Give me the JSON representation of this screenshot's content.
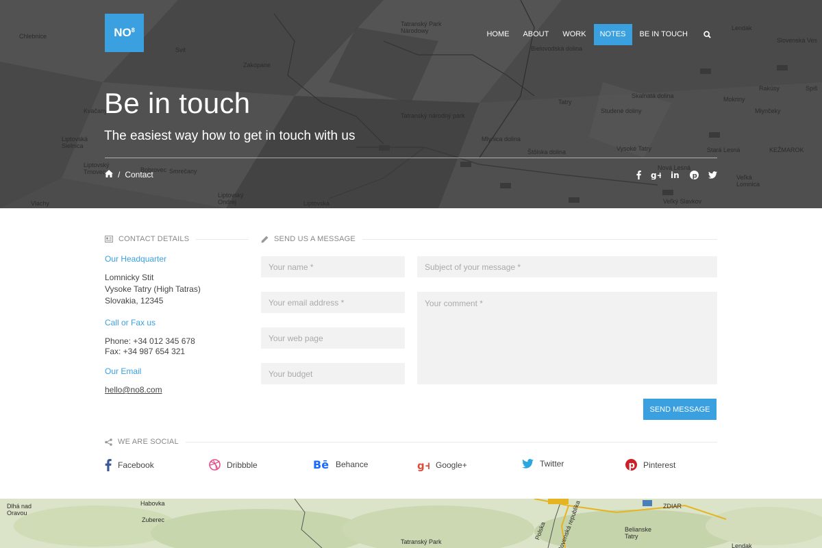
{
  "logo": {
    "text": "NO",
    "sup": "8"
  },
  "nav": {
    "items": [
      {
        "label": "HOME",
        "active": false
      },
      {
        "label": "ABOUT",
        "active": false
      },
      {
        "label": "WORK",
        "active": false
      },
      {
        "label": "NOTES",
        "active": true
      },
      {
        "label": "BE IN TOUCH",
        "active": false
      }
    ],
    "search_icon": "search-icon"
  },
  "hero": {
    "title": "Be in touch",
    "subtitle": "The easiest way how to get in touch with us",
    "breadcrumb": {
      "home_icon": "home-icon",
      "separator": "/",
      "current": "Contact"
    },
    "social_icons": [
      "facebook-icon",
      "google-plus-icon",
      "linkedin-icon",
      "pinterest-icon",
      "twitter-icon"
    ]
  },
  "map_labels": {
    "hero": [
      "Chlebnice",
      "Tatranský Park Národowy",
      "Lendak",
      "Slovenská Ves",
      "Svit",
      "Zakopane",
      "Bielovodská dolina",
      "Kvačany",
      "Tatranský národný park",
      "Skalnatá dolina",
      "Mokriny",
      "Rakúsy",
      "Mlynčeky",
      "Liptovská Sielnica",
      "Tatry",
      "Studené doliny",
      "Mlynica dolina",
      "Vysoké Tatry",
      "Stará Lesná",
      "KEŽMAROK",
      "Liptovský Trnovec",
      "Bobrovec",
      "Smrečany",
      "Štôlska dolina",
      "Nová Lesná",
      "Veľká Lomnica",
      "Liptovský Ondrej",
      "Vlachy",
      "Liptovská",
      "Veľký Slavkov",
      "Spiš"
    ],
    "bottom": [
      "Dlhá nad Oravou",
      "Habovka",
      "Zuberec",
      "Tatranský Park",
      "Belianske Tatry",
      "ZDIAR",
      "Lendak",
      "Polska",
      "Slovenská republika"
    ]
  },
  "contact": {
    "heading": "CONTACT DETAILS",
    "hq_label": "Our Headquarter",
    "address": [
      "Lomnicky Stit",
      "Vysoke Tatry (High Tatras)",
      "Slovakia, 12345"
    ],
    "phone_label": "Call or Fax us",
    "phone": "Phone: +34 012 345 678",
    "fax": "Fax: +34 987 654 321",
    "email_label": "Our Email",
    "email": "hello@no8.com"
  },
  "form": {
    "heading": "SEND US A MESSAGE",
    "name_placeholder": "Your name *",
    "subject_placeholder": "Subject of your message *",
    "email_placeholder": "Your email address *",
    "comment_placeholder": "Your comment *",
    "web_placeholder": "Your web page",
    "budget_placeholder": "Your budget",
    "send_label": "SEND MESSAGE"
  },
  "social": {
    "heading": "WE ARE SOCIAL",
    "items": [
      {
        "label": "Facebook",
        "icon": "facebook-icon",
        "color": "#3b5998"
      },
      {
        "label": "Dribbble",
        "icon": "dribbble-icon",
        "color": "#ea4c89"
      },
      {
        "label": "Behance",
        "icon": "behance-icon",
        "color": "#1769ff"
      },
      {
        "label": "Google+",
        "icon": "google-plus-icon",
        "color": "#dd4b39"
      },
      {
        "label": "Twitter",
        "icon": "twitter-icon",
        "color": "#2ba6e1"
      },
      {
        "label": "Pinterest",
        "icon": "pinterest-icon",
        "color": "#cb2027"
      }
    ]
  },
  "colors": {
    "accent": "#3aa0e0",
    "hero_bg": "#4a4a4a",
    "field_bg": "#f2f2f2",
    "map_bg": "#dfe7cf"
  }
}
